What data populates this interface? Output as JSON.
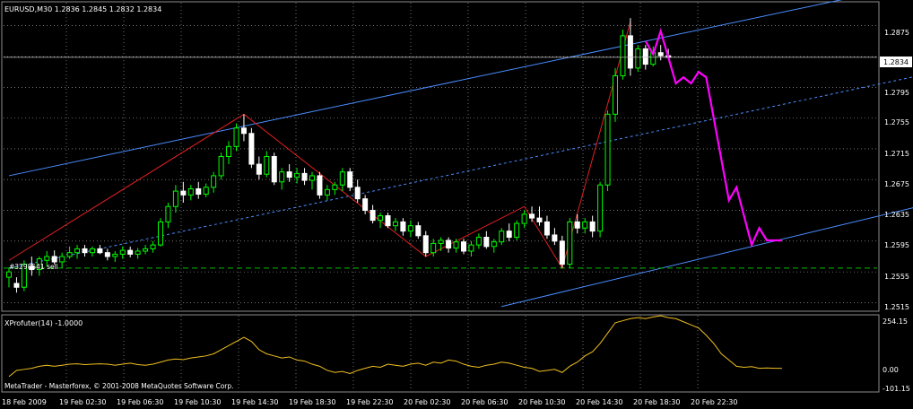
{
  "header": {
    "symbol_info": "EURUSD,M30  1.2836 1.2845 1.2832 1.2834",
    "order_label": "#3298541 sell"
  },
  "price_axis": {
    "ticks": [
      "1.2875",
      "1.2835",
      "1.2795",
      "1.2755",
      "1.2715",
      "1.2675",
      "1.2635",
      "1.2595",
      "1.2555",
      "1.2515"
    ],
    "current_price": "1.2834"
  },
  "indicator": {
    "label": "XProfuter(14) -1.0000",
    "ticks": [
      "254.15",
      "0.00",
      "-101.15"
    ]
  },
  "copyright": "MetaTrader - Masterforex, © 2001-2008 MetaQuotes Software Corp.",
  "time_axis": {
    "ticks": [
      "18 Feb 2009",
      "19 Feb 02:30",
      "19 Feb 06:30",
      "19 Feb 10:30",
      "19 Feb 14:30",
      "19 Feb 18:30",
      "19 Feb 22:30",
      "20 Feb 02:30",
      "20 Feb 06:30",
      "20 Feb 10:30",
      "20 Feb 14:30",
      "20 Feb 18:30",
      "20 Feb 22:30"
    ]
  },
  "colors": {
    "background": "#000000",
    "grid": "#b9b9b9",
    "bull_candle": "#00ff00",
    "bear_candle": "#ffffff",
    "channel": "#4a8cff",
    "zigzag": "#e02020",
    "forecast": "#ff00ff",
    "oscillator": "#f0c020",
    "support_level": "#00c000"
  },
  "chart_data": {
    "type": "candlestick",
    "y_range": [
      1.2505,
      1.2905
    ],
    "x_range": [
      0,
      120
    ],
    "candles": [
      {
        "x": 0,
        "o": 1.2548,
        "h": 1.256,
        "l": 1.2535,
        "c": 1.2555
      },
      {
        "x": 1,
        "o": 1.254,
        "h": 1.2548,
        "l": 1.2528,
        "c": 1.2535
      },
      {
        "x": 2,
        "o": 1.2535,
        "h": 1.257,
        "l": 1.253,
        "c": 1.2565
      },
      {
        "x": 3,
        "o": 1.2562,
        "h": 1.2575,
        "l": 1.255,
        "c": 1.2558
      },
      {
        "x": 4,
        "o": 1.2558,
        "h": 1.2575,
        "l": 1.255,
        "c": 1.2572
      },
      {
        "x": 5,
        "o": 1.257,
        "h": 1.2582,
        "l": 1.2562,
        "c": 1.2575
      },
      {
        "x": 6,
        "o": 1.2575,
        "h": 1.2583,
        "l": 1.2565,
        "c": 1.2568
      },
      {
        "x": 7,
        "o": 1.2568,
        "h": 1.258,
        "l": 1.256,
        "c": 1.2575
      },
      {
        "x": 8,
        "o": 1.2575,
        "h": 1.2588,
        "l": 1.2572,
        "c": 1.258
      },
      {
        "x": 9,
        "o": 1.258,
        "h": 1.259,
        "l": 1.2572,
        "c": 1.2585
      },
      {
        "x": 10,
        "o": 1.2585,
        "h": 1.259,
        "l": 1.2575,
        "c": 1.258
      },
      {
        "x": 11,
        "o": 1.258,
        "h": 1.2588,
        "l": 1.2575,
        "c": 1.2585
      },
      {
        "x": 12,
        "o": 1.2585,
        "h": 1.259,
        "l": 1.2578,
        "c": 1.258
      },
      {
        "x": 13,
        "o": 1.258,
        "h": 1.2585,
        "l": 1.257,
        "c": 1.2575
      },
      {
        "x": 14,
        "o": 1.2575,
        "h": 1.2582,
        "l": 1.2568,
        "c": 1.2578
      },
      {
        "x": 15,
        "o": 1.2578,
        "h": 1.2588,
        "l": 1.2572,
        "c": 1.2583
      },
      {
        "x": 16,
        "o": 1.2583,
        "h": 1.2588,
        "l": 1.2574,
        "c": 1.2578
      },
      {
        "x": 17,
        "o": 1.2578,
        "h": 1.2586,
        "l": 1.2572,
        "c": 1.2582
      },
      {
        "x": 18,
        "o": 1.2582,
        "h": 1.259,
        "l": 1.2578,
        "c": 1.2585
      },
      {
        "x": 19,
        "o": 1.2585,
        "h": 1.2595,
        "l": 1.258,
        "c": 1.259
      },
      {
        "x": 20,
        "o": 1.259,
        "h": 1.2625,
        "l": 1.2588,
        "c": 1.262
      },
      {
        "x": 21,
        "o": 1.262,
        "h": 1.2645,
        "l": 1.2612,
        "c": 1.264
      },
      {
        "x": 22,
        "o": 1.264,
        "h": 1.2668,
        "l": 1.2632,
        "c": 1.266
      },
      {
        "x": 23,
        "o": 1.266,
        "h": 1.2672,
        "l": 1.2645,
        "c": 1.2655
      },
      {
        "x": 24,
        "o": 1.2655,
        "h": 1.2668,
        "l": 1.2648,
        "c": 1.2663
      },
      {
        "x": 25,
        "o": 1.2663,
        "h": 1.2672,
        "l": 1.265,
        "c": 1.2656
      },
      {
        "x": 26,
        "o": 1.2656,
        "h": 1.267,
        "l": 1.2652,
        "c": 1.2665
      },
      {
        "x": 27,
        "o": 1.2665,
        "h": 1.2685,
        "l": 1.2658,
        "c": 1.268
      },
      {
        "x": 28,
        "o": 1.268,
        "h": 1.271,
        "l": 1.2675,
        "c": 1.2705
      },
      {
        "x": 29,
        "o": 1.2705,
        "h": 1.2725,
        "l": 1.2695,
        "c": 1.2718
      },
      {
        "x": 30,
        "o": 1.2718,
        "h": 1.2748,
        "l": 1.2712,
        "c": 1.2742
      },
      {
        "x": 31,
        "o": 1.2742,
        "h": 1.276,
        "l": 1.2725,
        "c": 1.2735
      },
      {
        "x": 32,
        "o": 1.2735,
        "h": 1.2742,
        "l": 1.269,
        "c": 1.2695
      },
      {
        "x": 33,
        "o": 1.2695,
        "h": 1.2705,
        "l": 1.2675,
        "c": 1.2682
      },
      {
        "x": 34,
        "o": 1.2682,
        "h": 1.2712,
        "l": 1.2678,
        "c": 1.2705
      },
      {
        "x": 35,
        "o": 1.2705,
        "h": 1.271,
        "l": 1.2668,
        "c": 1.2672
      },
      {
        "x": 36,
        "o": 1.2672,
        "h": 1.269,
        "l": 1.2662,
        "c": 1.2685
      },
      {
        "x": 37,
        "o": 1.2685,
        "h": 1.2695,
        "l": 1.2672,
        "c": 1.2678
      },
      {
        "x": 38,
        "o": 1.2678,
        "h": 1.269,
        "l": 1.267,
        "c": 1.2683
      },
      {
        "x": 39,
        "o": 1.2683,
        "h": 1.269,
        "l": 1.2668,
        "c": 1.2674
      },
      {
        "x": 40,
        "o": 1.2674,
        "h": 1.2685,
        "l": 1.2662,
        "c": 1.268
      },
      {
        "x": 41,
        "o": 1.268,
        "h": 1.2685,
        "l": 1.265,
        "c": 1.2655
      },
      {
        "x": 42,
        "o": 1.2655,
        "h": 1.2668,
        "l": 1.2648,
        "c": 1.2662
      },
      {
        "x": 43,
        "o": 1.2662,
        "h": 1.2672,
        "l": 1.2655,
        "c": 1.2668
      },
      {
        "x": 44,
        "o": 1.2668,
        "h": 1.269,
        "l": 1.266,
        "c": 1.2685
      },
      {
        "x": 45,
        "o": 1.2685,
        "h": 1.269,
        "l": 1.266,
        "c": 1.2665
      },
      {
        "x": 46,
        "o": 1.2665,
        "h": 1.2675,
        "l": 1.2645,
        "c": 1.265
      },
      {
        "x": 47,
        "o": 1.265,
        "h": 1.2655,
        "l": 1.263,
        "c": 1.2635
      },
      {
        "x": 48,
        "o": 1.2635,
        "h": 1.2642,
        "l": 1.2618,
        "c": 1.2622
      },
      {
        "x": 49,
        "o": 1.2622,
        "h": 1.2632,
        "l": 1.2612,
        "c": 1.2628
      },
      {
        "x": 50,
        "o": 1.2628,
        "h": 1.2632,
        "l": 1.2612,
        "c": 1.2615
      },
      {
        "x": 51,
        "o": 1.2615,
        "h": 1.2625,
        "l": 1.2608,
        "c": 1.262
      },
      {
        "x": 52,
        "o": 1.262,
        "h": 1.2625,
        "l": 1.2602,
        "c": 1.2608
      },
      {
        "x": 53,
        "o": 1.2608,
        "h": 1.2622,
        "l": 1.26,
        "c": 1.2615
      },
      {
        "x": 54,
        "o": 1.2615,
        "h": 1.262,
        "l": 1.2598,
        "c": 1.2602
      },
      {
        "x": 55,
        "o": 1.2602,
        "h": 1.2608,
        "l": 1.2575,
        "c": 1.258
      },
      {
        "x": 56,
        "o": 1.258,
        "h": 1.2598,
        "l": 1.2575,
        "c": 1.2592
      },
      {
        "x": 57,
        "o": 1.2592,
        "h": 1.26,
        "l": 1.2582,
        "c": 1.2596
      },
      {
        "x": 58,
        "o": 1.2596,
        "h": 1.26,
        "l": 1.258,
        "c": 1.2586
      },
      {
        "x": 59,
        "o": 1.2586,
        "h": 1.2598,
        "l": 1.258,
        "c": 1.2594
      },
      {
        "x": 60,
        "o": 1.2594,
        "h": 1.2598,
        "l": 1.2578,
        "c": 1.2582
      },
      {
        "x": 61,
        "o": 1.2582,
        "h": 1.2595,
        "l": 1.2575,
        "c": 1.259
      },
      {
        "x": 62,
        "o": 1.259,
        "h": 1.2605,
        "l": 1.2585,
        "c": 1.26
      },
      {
        "x": 63,
        "o": 1.26,
        "h": 1.2608,
        "l": 1.2585,
        "c": 1.2588
      },
      {
        "x": 64,
        "o": 1.2588,
        "h": 1.2598,
        "l": 1.258,
        "c": 1.2594
      },
      {
        "x": 65,
        "o": 1.2594,
        "h": 1.2612,
        "l": 1.259,
        "c": 1.2608
      },
      {
        "x": 66,
        "o": 1.2608,
        "h": 1.2618,
        "l": 1.2595,
        "c": 1.26
      },
      {
        "x": 67,
        "o": 1.26,
        "h": 1.2622,
        "l": 1.2596,
        "c": 1.2618
      },
      {
        "x": 68,
        "o": 1.2618,
        "h": 1.2635,
        "l": 1.2612,
        "c": 1.263
      },
      {
        "x": 69,
        "o": 1.263,
        "h": 1.264,
        "l": 1.262,
        "c": 1.2625
      },
      {
        "x": 70,
        "o": 1.2625,
        "h": 1.264,
        "l": 1.2615,
        "c": 1.262
      },
      {
        "x": 71,
        "o": 1.262,
        "h": 1.2628,
        "l": 1.2598,
        "c": 1.2603
      },
      {
        "x": 72,
        "o": 1.2603,
        "h": 1.2612,
        "l": 1.259,
        "c": 1.2595
      },
      {
        "x": 73,
        "o": 1.2595,
        "h": 1.2602,
        "l": 1.256,
        "c": 1.2565
      },
      {
        "x": 74,
        "o": 1.2565,
        "h": 1.2625,
        "l": 1.256,
        "c": 1.262
      },
      {
        "x": 75,
        "o": 1.262,
        "h": 1.263,
        "l": 1.2605,
        "c": 1.2612
      },
      {
        "x": 76,
        "o": 1.2612,
        "h": 1.2625,
        "l": 1.2605,
        "c": 1.262
      },
      {
        "x": 77,
        "o": 1.262,
        "h": 1.2628,
        "l": 1.26,
        "c": 1.2608
      },
      {
        "x": 78,
        "o": 1.2608,
        "h": 1.2672,
        "l": 1.26,
        "c": 1.2668
      },
      {
        "x": 79,
        "o": 1.2668,
        "h": 1.2765,
        "l": 1.266,
        "c": 1.276
      },
      {
        "x": 80,
        "o": 1.276,
        "h": 1.282,
        "l": 1.275,
        "c": 1.281
      },
      {
        "x": 81,
        "o": 1.281,
        "h": 1.287,
        "l": 1.2805,
        "c": 1.2862
      },
      {
        "x": 82,
        "o": 1.2862,
        "h": 1.2885,
        "l": 1.281,
        "c": 1.282
      },
      {
        "x": 83,
        "o": 1.282,
        "h": 1.285,
        "l": 1.2815,
        "c": 1.2845
      },
      {
        "x": 84,
        "o": 1.2845,
        "h": 1.285,
        "l": 1.2818,
        "c": 1.2825
      },
      {
        "x": 85,
        "o": 1.2825,
        "h": 1.2848,
        "l": 1.2822,
        "c": 1.284
      },
      {
        "x": 86,
        "o": 1.284,
        "h": 1.285,
        "l": 1.283,
        "c": 1.2836
      },
      {
        "x": 87,
        "o": 1.2836,
        "h": 1.2845,
        "l": 1.2832,
        "c": 1.2834
      }
    ],
    "channel_lines": [
      {
        "name": "upper",
        "style": "solid",
        "points": [
          [
            0,
            1.268
          ],
          [
            120,
            1.293
          ]
        ]
      },
      {
        "name": "mid",
        "style": "dashed",
        "points": [
          [
            0,
            1.256
          ],
          [
            120,
            1.281
          ]
        ]
      },
      {
        "name": "lower",
        "style": "solid",
        "points": [
          [
            65,
            1.251
          ],
          [
            120,
            1.264
          ]
        ]
      }
    ],
    "zigzag": [
      [
        0,
        1.257
      ],
      [
        31,
        1.276
      ],
      [
        55,
        1.2575
      ],
      [
        68,
        1.264
      ],
      [
        73,
        1.256
      ],
      [
        82,
        1.288
      ]
    ],
    "forecast": [
      [
        84,
        1.2855
      ],
      [
        85,
        1.2838
      ],
      [
        86,
        1.2868
      ],
      [
        88,
        1.28
      ],
      [
        89,
        1.2808
      ],
      [
        90,
        1.28
      ],
      [
        91,
        1.2815
      ],
      [
        92,
        1.2808
      ],
      [
        95,
        1.2648
      ],
      [
        96,
        1.2665
      ],
      [
        98,
        1.259
      ],
      [
        99,
        1.2612
      ],
      [
        100,
        1.2596
      ],
      [
        102,
        1.2596
      ]
    ],
    "support_level": 1.256,
    "oscillator": {
      "y_range": [
        -101.15,
        254.15
      ],
      "values": [
        [
          0,
          -40
        ],
        [
          1,
          -10
        ],
        [
          2,
          -5
        ],
        [
          3,
          0
        ],
        [
          4,
          10
        ],
        [
          5,
          15
        ],
        [
          6,
          10
        ],
        [
          7,
          15
        ],
        [
          8,
          20
        ],
        [
          9,
          22
        ],
        [
          10,
          18
        ],
        [
          11,
          20
        ],
        [
          12,
          22
        ],
        [
          13,
          20
        ],
        [
          14,
          15
        ],
        [
          15,
          20
        ],
        [
          16,
          25
        ],
        [
          17,
          18
        ],
        [
          18,
          15
        ],
        [
          19,
          20
        ],
        [
          20,
          30
        ],
        [
          21,
          40
        ],
        [
          22,
          45
        ],
        [
          23,
          42
        ],
        [
          24,
          50
        ],
        [
          25,
          55
        ],
        [
          26,
          60
        ],
        [
          27,
          70
        ],
        [
          28,
          90
        ],
        [
          29,
          110
        ],
        [
          30,
          130
        ],
        [
          31,
          150
        ],
        [
          32,
          130
        ],
        [
          33,
          90
        ],
        [
          34,
          70
        ],
        [
          35,
          60
        ],
        [
          36,
          50
        ],
        [
          37,
          55
        ],
        [
          38,
          40
        ],
        [
          39,
          35
        ],
        [
          40,
          20
        ],
        [
          41,
          10
        ],
        [
          42,
          -10
        ],
        [
          43,
          -20
        ],
        [
          44,
          -15
        ],
        [
          45,
          -25
        ],
        [
          46,
          -10
        ],
        [
          47,
          0
        ],
        [
          48,
          10
        ],
        [
          49,
          5
        ],
        [
          50,
          20
        ],
        [
          51,
          15
        ],
        [
          52,
          10
        ],
        [
          53,
          20
        ],
        [
          54,
          25
        ],
        [
          55,
          15
        ],
        [
          56,
          30
        ],
        [
          57,
          25
        ],
        [
          58,
          40
        ],
        [
          59,
          35
        ],
        [
          60,
          20
        ],
        [
          61,
          10
        ],
        [
          62,
          5
        ],
        [
          63,
          15
        ],
        [
          64,
          20
        ],
        [
          65,
          30
        ],
        [
          66,
          25
        ],
        [
          67,
          15
        ],
        [
          68,
          5
        ],
        [
          69,
          0
        ],
        [
          70,
          -15
        ],
        [
          71,
          -10
        ],
        [
          72,
          -5
        ],
        [
          73,
          -20
        ],
        [
          74,
          10
        ],
        [
          75,
          30
        ],
        [
          76,
          60
        ],
        [
          77,
          80
        ],
        [
          78,
          120
        ],
        [
          79,
          170
        ],
        [
          80,
          220
        ],
        [
          81,
          230
        ],
        [
          82,
          240
        ],
        [
          83,
          245
        ],
        [
          84,
          240
        ],
        [
          85,
          248
        ],
        [
          86,
          254
        ],
        [
          87,
          245
        ],
        [
          88,
          240
        ],
        [
          89,
          225
        ],
        [
          90,
          210
        ],
        [
          91,
          195
        ],
        [
          92,
          160
        ],
        [
          93,
          120
        ],
        [
          94,
          70
        ],
        [
          95,
          40
        ],
        [
          96,
          10
        ],
        [
          97,
          5
        ],
        [
          98,
          8
        ],
        [
          99,
          0
        ],
        [
          100,
          2
        ],
        [
          101,
          0
        ],
        [
          102,
          0
        ]
      ]
    }
  }
}
